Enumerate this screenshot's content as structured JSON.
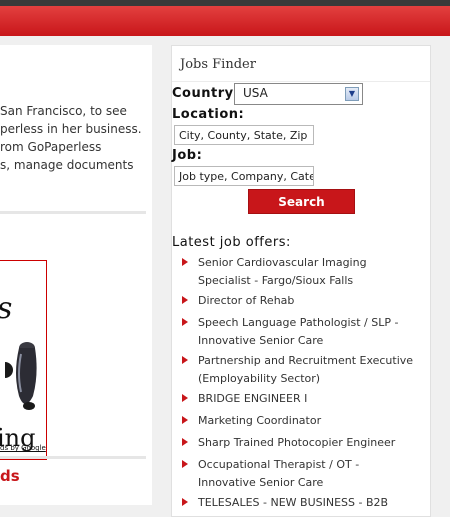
{
  "article": {
    "lines": [
      "San Francisco, to see",
      "perless in her business.",
      "rom GoPaperless",
      "s, manage documents"
    ]
  },
  "ad": {
    "letter_top": "s",
    "letters_bottom": "ing",
    "ads_by_google": "ds by Google"
  },
  "left_heading": "ds",
  "jobs_finder": {
    "title": "Jobs Finder",
    "country_label": "Country:",
    "country_value": "USA",
    "location_label": "Location:",
    "location_value": "City, County, State, Zip",
    "job_label": "Job:",
    "job_value": "Job type, Company, Cate",
    "search_label": "Search"
  },
  "latest": {
    "title": "Latest job offers:",
    "items": [
      "Senior Cardiovascular Imaging Specialist - Fargo/Sioux Falls",
      "Director of Rehab",
      "Speech Language Pathologist / SLP - Innovative Senior Care",
      "Partnership and Recruitment Executive (Employability Sector)",
      "BRIDGE ENGINEER I",
      "Marketing Coordinator",
      "Sharp Trained Photocopier Engineer",
      "Occupational Therapist / OT - Innovative Senior Care",
      "TELESALES - NEW BUSINESS - B2B"
    ]
  },
  "colors": {
    "brand_red": "#c8161a",
    "panel_bg": "#ffffff"
  }
}
